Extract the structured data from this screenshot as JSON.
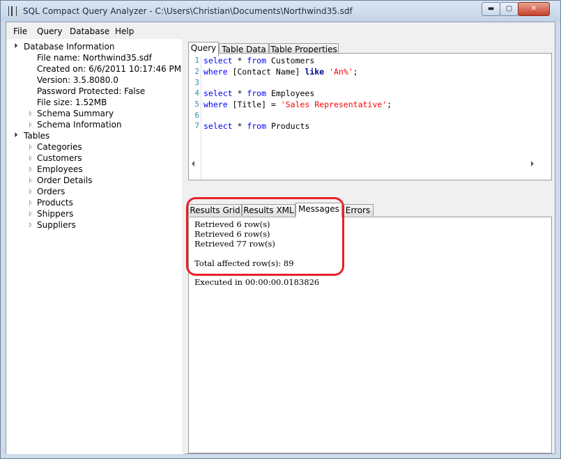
{
  "window": {
    "title": "SQL Compact Query Analyzer - C:\\Users\\Christian\\Documents\\Northwind35.sdf",
    "min_label": "▬",
    "max_label": "▢",
    "close_label": "✕"
  },
  "menu": {
    "items": [
      "File",
      "Query",
      "Database",
      "Help"
    ]
  },
  "tree": {
    "database_info": "Database Information",
    "file_name": "File name:  Northwind35.sdf",
    "created_on": "Created on:  6/6/2011 10:17:46 PM",
    "version": "Version:  3.5.8080.0",
    "password_protected": "Password Protected:  False",
    "file_size": "File size:  1.52MB",
    "schema_summary": "Schema Summary",
    "schema_information": "Schema Information",
    "tables": "Tables",
    "table_items": [
      "Categories",
      "Customers",
      "Employees",
      "Order Details",
      "Orders",
      "Products",
      "Shippers",
      "Suppliers"
    ]
  },
  "top_tabs": [
    "Query",
    "Table Data",
    "Table Properties"
  ],
  "editor": {
    "line_numbers": [
      "1",
      "2",
      "3",
      "4",
      "5",
      "6",
      "7"
    ],
    "lines": [
      [
        {
          "t": "select",
          "c": "kw"
        },
        {
          "t": " * ",
          "c": ""
        },
        {
          "t": "from",
          "c": "kw"
        },
        {
          "t": " Customers",
          "c": ""
        }
      ],
      [
        {
          "t": "where",
          "c": "kw"
        },
        {
          "t": " [Contact Name] ",
          "c": ""
        },
        {
          "t": "like",
          "c": "kw2"
        },
        {
          "t": " ",
          "c": ""
        },
        {
          "t": "'An%'",
          "c": "str"
        },
        {
          "t": ";",
          "c": ""
        }
      ],
      [],
      [
        {
          "t": "select",
          "c": "kw"
        },
        {
          "t": " * ",
          "c": ""
        },
        {
          "t": "from",
          "c": "kw"
        },
        {
          "t": " Employees",
          "c": ""
        }
      ],
      [
        {
          "t": "where",
          "c": "kw"
        },
        {
          "t": " [Title] = ",
          "c": ""
        },
        {
          "t": "'Sales Representative'",
          "c": "str"
        },
        {
          "t": ";",
          "c": ""
        }
      ],
      [],
      [
        {
          "t": "select",
          "c": "kw"
        },
        {
          "t": " * ",
          "c": ""
        },
        {
          "t": "from",
          "c": "kw"
        },
        {
          "t": " Products",
          "c": ""
        }
      ]
    ]
  },
  "result_tabs": [
    "Results Grid",
    "Results XML",
    "Messages",
    "Errors"
  ],
  "messages": [
    "Retrieved 6 row(s)",
    "Retrieved 6 row(s)",
    "Retrieved 77 row(s)",
    "",
    "Total affected row(s): 89",
    "",
    "Executed in 00:00:00.0183826"
  ],
  "colors": {
    "keyword": "#0000ff",
    "string": "#ff0000",
    "line_number": "#2b91af",
    "highlight": "#e8202a"
  }
}
